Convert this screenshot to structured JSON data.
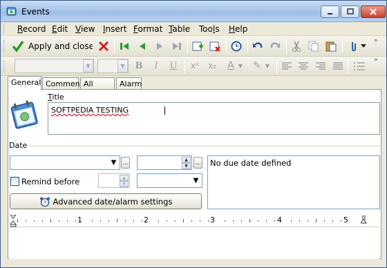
{
  "window": {
    "title": "Events"
  },
  "menu": [
    {
      "label": "Record",
      "u": "R",
      "rest": "ecord"
    },
    {
      "label": "Edit",
      "u": "E",
      "rest": "dit"
    },
    {
      "label": "View",
      "u": "V",
      "rest": "iew"
    },
    {
      "label": "Insert",
      "u": "I",
      "rest": "nsert"
    },
    {
      "label": "Format",
      "u": "F",
      "rest": "ormat"
    },
    {
      "label": "Table",
      "u": "T",
      "rest": "able"
    },
    {
      "label": "Tools",
      "pre": "Too",
      "u": "l",
      "rest": "s"
    },
    {
      "label": "Help",
      "u": "H",
      "rest": "elp"
    }
  ],
  "toolbar": {
    "apply_label": "Apply and close"
  },
  "tabs": [
    "General",
    "Comment",
    "All fields",
    "Alarm"
  ],
  "general": {
    "title_label_u": "T",
    "title_label_rest": "itle",
    "title_value": "SOFTPEDIA TESTING",
    "date_label": "Date",
    "remind_label": "Remind before",
    "due_text": "No due date defined",
    "advanced_button": "Advanced date/alarm settings"
  },
  "ruler": {
    "numbers": [
      "1",
      "2",
      "3",
      "4",
      "5"
    ]
  }
}
